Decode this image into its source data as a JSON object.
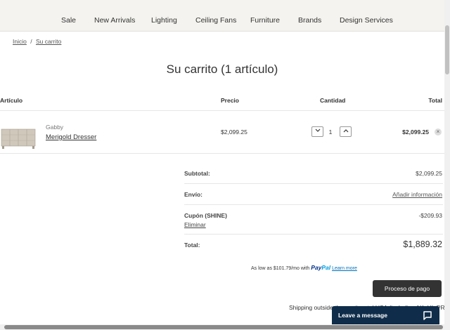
{
  "nav": {
    "items": [
      "Sale",
      "New Arrivals",
      "Lighting",
      "Ceiling Fans",
      "Furniture",
      "Brands",
      "Design Services"
    ]
  },
  "breadcrumb": {
    "home": "Inicio",
    "separator": "/",
    "current": "Su carrito"
  },
  "page_title": "Su carrito (1 artículo)",
  "table": {
    "headers": {
      "item": "Artículo",
      "price": "Precio",
      "quantity": "Cantidad",
      "total": "Total"
    }
  },
  "cart_item": {
    "brand": "Gabby",
    "name": "Merigold Dresser",
    "price": "$2,099.25",
    "quantity": "1",
    "total": "$2,099.25",
    "decrease_icon": "chevron-down-icon",
    "increase_icon": "chevron-up-icon",
    "remove_icon": "close-icon"
  },
  "summary": {
    "subtotal_label": "Subtotal:",
    "subtotal_value": "$2,099.25",
    "shipping_label": "Envío:",
    "shipping_link": "Añadir información",
    "coupon_label": "Cupón (SHINE)",
    "coupon_remove": "Eliminar",
    "coupon_value": "-$209.93",
    "total_label": "Total:",
    "total_value": "$1,889.32"
  },
  "paypal": {
    "text": "As low as $101.79/mo with",
    "brand_pay": "Pay",
    "brand_pal": "Pal",
    "learn_more": "Learn more"
  },
  "checkout_button": "Proceso de pago",
  "shipping_note": "Shipping outside the continental USA (including AK, HI, PR)?",
  "chat": {
    "label": "Leave a message",
    "icon": "chat-bubble-icon"
  },
  "colors": {
    "nav_bg": "#f4f3ef",
    "checkout_bg": "#333333",
    "chat_bg": "#0f2d4a",
    "paypal_dark": "#003087",
    "paypal_light": "#009cde"
  }
}
